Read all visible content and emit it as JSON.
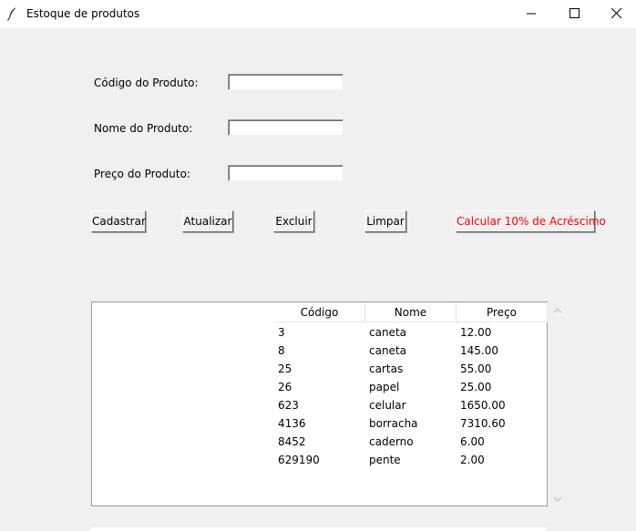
{
  "window": {
    "title": "Estoque de produtos"
  },
  "form": {
    "codigo_label": "Código do Produto:",
    "codigo_value": "",
    "nome_label": "Nome do Produto:",
    "nome_value": "",
    "preco_label": "Preço do Produto:",
    "preco_value": ""
  },
  "buttons": {
    "cadastrar": "Cadastrar",
    "atualizar": "Atualizar",
    "excluir": "Excluir",
    "limpar": "Limpar",
    "calcular": "Calcular 10% de Acréscimo"
  },
  "table": {
    "columns": [
      "Código",
      "Nome",
      "Preço"
    ],
    "rows": [
      [
        "3",
        "caneta",
        "12.00"
      ],
      [
        "8",
        "caneta",
        "145.00"
      ],
      [
        "25",
        "cartas",
        "55.00"
      ],
      [
        "26",
        "papel",
        "25.00"
      ],
      [
        "623",
        "celular",
        "1650.00"
      ],
      [
        "4136",
        "borracha",
        "7310.60"
      ],
      [
        "8452",
        "caderno",
        "6.00"
      ],
      [
        "629190",
        "pente",
        "2.00"
      ]
    ]
  },
  "colors": {
    "accent_button_text": "#ff0000",
    "window_background": "#f0f0f0"
  },
  "icons": {
    "app": "feather-icon",
    "minimize": "minimize-icon",
    "maximize": "maximize-icon",
    "close": "close-icon",
    "scroll_up": "chevron-up-icon",
    "scroll_down": "chevron-down-icon"
  }
}
